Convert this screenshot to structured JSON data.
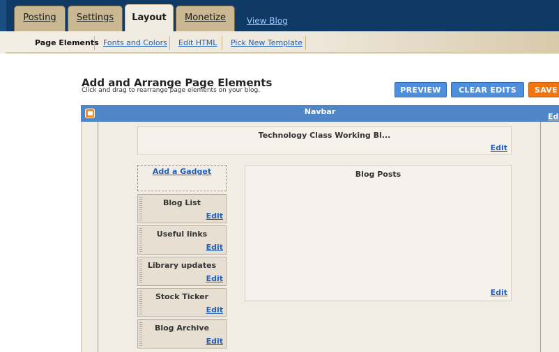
{
  "tabs": [
    {
      "label": "Posting",
      "active": false
    },
    {
      "label": "Settings",
      "active": false
    },
    {
      "label": "Layout",
      "active": true
    },
    {
      "label": "Monetize",
      "active": false
    }
  ],
  "view_blog": "View Blog",
  "subtabs": [
    {
      "label": "Page Elements",
      "active": true
    },
    {
      "label": "Fonts and Colors",
      "active": false
    },
    {
      "label": "Edit HTML",
      "active": false
    },
    {
      "label": "Pick New Template",
      "active": false
    }
  ],
  "page": {
    "title": "Add and Arrange Page Elements",
    "subtitle": "Click and drag to rearrange page elements on your blog."
  },
  "actions": {
    "preview": "PREVIEW",
    "clear_edits": "CLEAR EDITS",
    "save": "SAVE"
  },
  "navbar": {
    "title": "Navbar",
    "edit": "Edit",
    "icon": "blogger-icon"
  },
  "header_gadget": {
    "title": "Technology Class Working Bl...",
    "edit": "Edit"
  },
  "add_gadget": "Add a Gadget",
  "sidebar_gadgets": [
    {
      "title": "Blog List",
      "edit": "Edit"
    },
    {
      "title": "Useful links",
      "edit": "Edit"
    },
    {
      "title": "Library updates",
      "edit": "Edit"
    },
    {
      "title": "Stock Ticker",
      "edit": "Edit"
    },
    {
      "title": "Blog Archive",
      "edit": "Edit"
    }
  ],
  "blog_posts": {
    "title": "Blog Posts",
    "edit": "Edit"
  },
  "colors": {
    "topbar": "#0f3a66",
    "tab": "#c9b891",
    "active_tab": "#f1ece1",
    "navbar": "#4f86c7",
    "preview_button": "#4d8fdc",
    "save_button": "#f2740f",
    "link": "#1f5fb8"
  }
}
